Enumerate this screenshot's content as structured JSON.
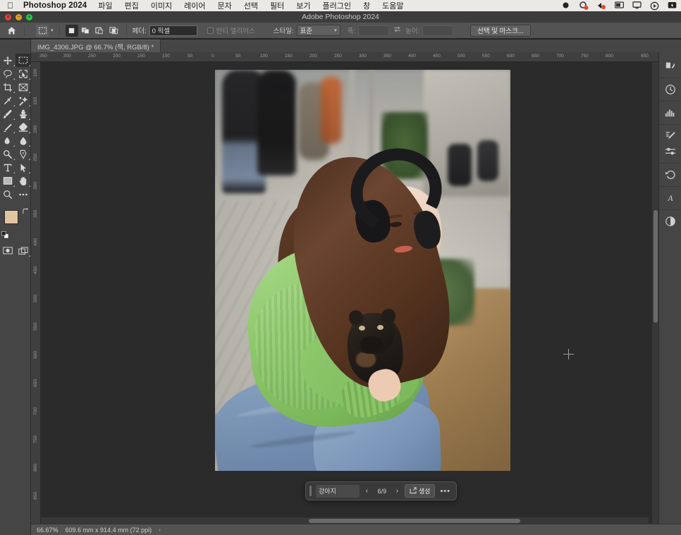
{
  "macbar": {
    "app_name": "Photoshop 2024",
    "apple_logo": "apple-logo",
    "menus": [
      "파일",
      "편집",
      "이미지",
      "레이어",
      "문자",
      "선택",
      "필터",
      "보기",
      "플러그인",
      "창",
      "도움말"
    ],
    "status_icons": [
      "record-dot-icon",
      "control-center-icon",
      "battery-icon",
      "display-icon",
      "screen-icon",
      "siri-icon",
      "charge-icon"
    ]
  },
  "titlebar": {
    "title": "Adobe Photoshop 2024",
    "close_label": "×",
    "minimize_label": "−",
    "zoom_label": "+"
  },
  "options_bar": {
    "home_icon": "home-icon",
    "tool_preset": "rectangular-marquee-icon",
    "tool_caret": "▾",
    "selection_modes": [
      "new-selection",
      "add-to-selection",
      "subtract-from-selection",
      "intersect-with-selection"
    ],
    "active_selection_mode": 0,
    "feather_label": "페더:",
    "feather_value": "0 픽셀",
    "antialias_label": "안티 앨리어스",
    "antialias_checked": false,
    "style_label": "스타일:",
    "style_value": "표준",
    "width_label": "폭:",
    "width_value": "",
    "swap_icon": "swap-width-height-icon",
    "height_label": "높이:",
    "height_value": "",
    "select_and_mask_label": "선택 및 마스크..."
  },
  "document_tab": {
    "title": "IMG_4306.JPG @ 66.7% (책, RGB/8) *"
  },
  "toolbar": {
    "tools": [
      {
        "name": "move-tool",
        "glyph": "move"
      },
      {
        "name": "rectangular-marquee-tool",
        "glyph": "marquee",
        "selected": true
      },
      {
        "name": "lasso-tool",
        "glyph": "lasso"
      },
      {
        "name": "object-selection-tool",
        "glyph": "objectselect"
      },
      {
        "name": "crop-tool",
        "glyph": "crop"
      },
      {
        "name": "frame-tool",
        "glyph": "frame"
      },
      {
        "name": "eyedropper-tool",
        "glyph": "eyedropper"
      },
      {
        "name": "spot-healing-brush-tool",
        "glyph": "healing"
      },
      {
        "name": "brush-tool",
        "glyph": "brush"
      },
      {
        "name": "clone-stamp-tool",
        "glyph": "stamp"
      },
      {
        "name": "history-brush-tool",
        "glyph": "historybrush"
      },
      {
        "name": "eraser-tool",
        "glyph": "eraser"
      },
      {
        "name": "gradient-tool",
        "glyph": "gradient"
      },
      {
        "name": "blur-tool",
        "glyph": "blur"
      },
      {
        "name": "dodge-tool",
        "glyph": "dodge"
      },
      {
        "name": "pen-tool",
        "glyph": "pen"
      },
      {
        "name": "type-tool",
        "glyph": "type"
      },
      {
        "name": "path-selection-tool",
        "glyph": "pathselect"
      },
      {
        "name": "shape-tool",
        "glyph": "shape"
      },
      {
        "name": "hand-tool",
        "glyph": "hand"
      },
      {
        "name": "zoom-tool",
        "glyph": "zoom"
      },
      {
        "name": "edit-toolbar-tool",
        "glyph": "more"
      }
    ],
    "foreground_color": "#e3c4a0",
    "background_color": "#ffffff",
    "swap_colors_icon": "swap-colors-icon",
    "default_colors_icon": "default-colors-icon",
    "quick_mask_icon": "quick-mask-icon",
    "screen_mode_icon": "screen-mode-icon"
  },
  "right_dock": {
    "items": [
      {
        "name": "color-panel-icon",
        "glyph": "color"
      },
      {
        "name": "history-panel-icon",
        "glyph": "history"
      },
      {
        "name": "histogram-panel-icon",
        "glyph": "histogram"
      },
      {
        "name": "adjustments-panel-icon",
        "glyph": "adjustments"
      },
      {
        "name": "properties-panel-icon",
        "glyph": "sliders"
      },
      {
        "name": "undo-panel-icon",
        "glyph": "undo"
      },
      {
        "name": "character-panel-icon",
        "glyph": "character"
      },
      {
        "name": "layers-panel-icon",
        "glyph": "layers"
      }
    ]
  },
  "rulers": {
    "horizontal_ticks": [
      "350",
      "300",
      "250",
      "200",
      "150",
      "100",
      "50",
      "0",
      "50",
      "100",
      "150",
      "200",
      "250",
      "300",
      "350",
      "400",
      "450",
      "500",
      "550",
      "600",
      "650",
      "700",
      "750",
      "800",
      "850"
    ],
    "vertical_ticks": [
      "100",
      "150",
      "200",
      "250",
      "300",
      "350",
      "400",
      "450",
      "500",
      "550",
      "600",
      "650",
      "700",
      "750",
      "800",
      "850"
    ],
    "units": "mm"
  },
  "generative_taskbar": {
    "prompt_value": "강아지",
    "prompt_placeholder": "강아지",
    "prev_icon": "‹",
    "next_icon": "›",
    "variation_count": "6/9",
    "generate_icon": "generate-icon",
    "generate_label": "생성",
    "more_label": "•••"
  },
  "statusbar": {
    "zoom_level": "66.67%",
    "document_size": "609.6 mm x 914.4 mm (72 ppi)",
    "expand_arrow": "›"
  },
  "canvas": {
    "cursor": "crosshair-cursor",
    "image_alt": "IMG_4306.JPG"
  }
}
